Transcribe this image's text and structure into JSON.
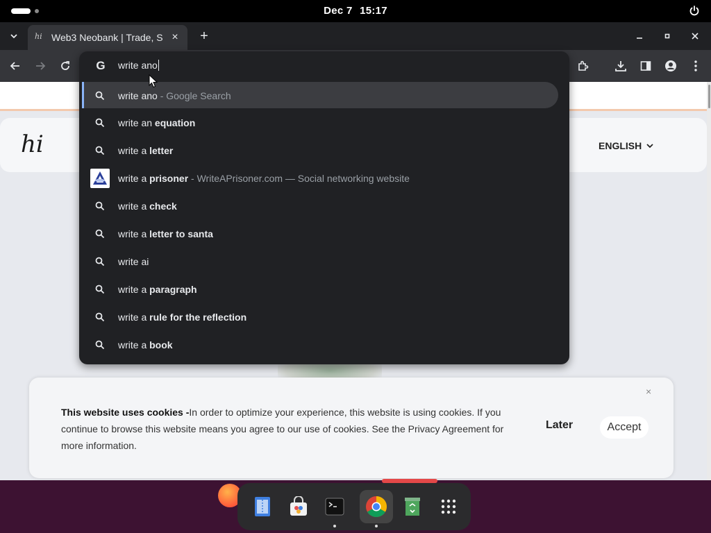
{
  "topbar": {
    "date": "Dec 7",
    "time": "15:17"
  },
  "browser": {
    "tab_title": "Web3 Neobank | Trade, S",
    "favicon_text": "hi",
    "omnibox_value": "write ano"
  },
  "suggestions": [
    {
      "prefix": "write ano",
      "bold": "",
      "sub": " - Google Search",
      "icon": "search-icon",
      "selected": true
    },
    {
      "prefix": "write an ",
      "bold": "equation",
      "sub": "",
      "icon": "search-icon"
    },
    {
      "prefix": "write a ",
      "bold": "letter",
      "sub": "",
      "icon": "search-icon"
    },
    {
      "prefix": "write a ",
      "bold": "prisoner",
      "sub": " - WriteAPrisoner.com — Social networking website",
      "icon": "site-favicon"
    },
    {
      "prefix": "write a ",
      "bold": "check",
      "sub": "",
      "icon": "search-icon"
    },
    {
      "prefix": "write a ",
      "bold": "letter to santa",
      "sub": "",
      "icon": "search-icon"
    },
    {
      "prefix": "write ai",
      "bold": "",
      "sub": "",
      "icon": "search-icon"
    },
    {
      "prefix": "write a ",
      "bold": "paragraph",
      "sub": "",
      "icon": "search-icon"
    },
    {
      "prefix": "write a ",
      "bold": "rule for the reflection",
      "sub": "",
      "icon": "search-icon"
    },
    {
      "prefix": "write a ",
      "bold": "book",
      "sub": "",
      "icon": "search-icon"
    }
  ],
  "site": {
    "logo_text": "hi",
    "language": "ENGLISH"
  },
  "cookie": {
    "title": "This website uses cookies -",
    "body": "In order to optimize your experience, this website is using cookies. If you continue to browse this website means you agree to our use of cookies. See the Privacy Agreement for more information.",
    "later_label": "Later",
    "accept_label": "Accept"
  },
  "dock": {
    "items": [
      "text-editor-icon",
      "software-store-icon",
      "terminal-icon",
      "chrome-icon",
      "trash-icon",
      "app-grid-icon"
    ]
  },
  "colors": {
    "omnibox_bg": "#202124",
    "selected_row": "#3c3d41",
    "accent": "#8ab4f8",
    "dock_bg": "#2b2b2d",
    "desktop_bg": "#3d1232"
  }
}
